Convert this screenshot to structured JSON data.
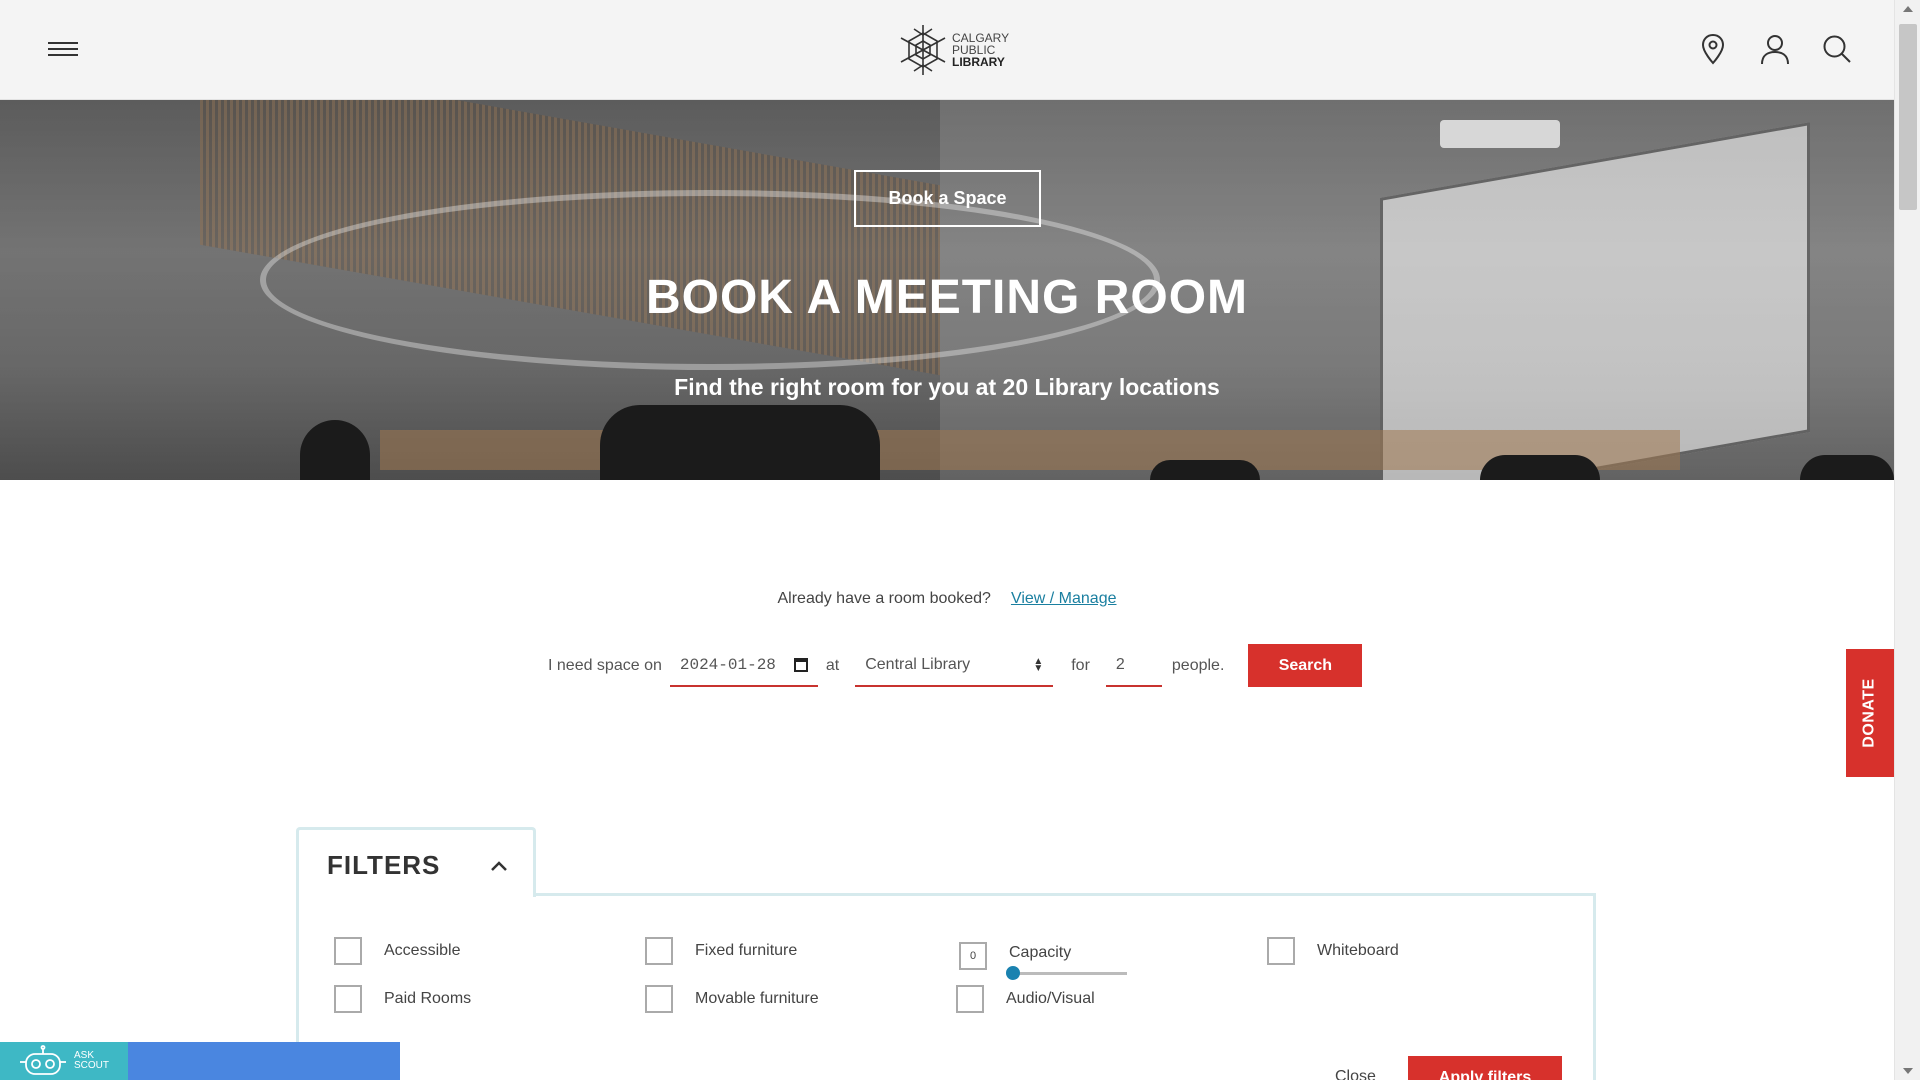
{
  "header": {
    "logo": {
      "line1": "CALGARY",
      "line2": "PUBLIC",
      "line3": "LIBRARY"
    },
    "icons": [
      "menu-icon",
      "location-pin-icon",
      "user-icon",
      "search-icon"
    ]
  },
  "hero": {
    "button_label": "Book a Space",
    "title": "BOOK A MEETING ROOM",
    "subtitle": "Find the right room for you at 20 Library locations"
  },
  "booking": {
    "already_text": "Already have a room booked?",
    "manage_link": "View / Manage",
    "label_space_on": "I need space on",
    "date_value": "2024-01-28",
    "label_at": "at",
    "location_value": "Central Library",
    "label_for": "for",
    "people_value": "2",
    "label_people": "people.",
    "search_label": "Search"
  },
  "donate_label": "DONATE",
  "filters": {
    "title": "FILTERS",
    "options": {
      "accessible": "Accessible",
      "paid_rooms": "Paid Rooms",
      "fixed_furniture": "Fixed furniture",
      "movable_furniture": "Movable furniture",
      "capacity": "Capacity",
      "capacity_value": "0",
      "audio_visual": "Audio/Visual",
      "whiteboard": "Whiteboard"
    },
    "close_label": "Close",
    "apply_label": "Apply filters"
  },
  "scout": {
    "line1": "ASK",
    "line2": "SCOUT"
  },
  "colors": {
    "accent_red": "#d7312c",
    "link_blue": "#1a7fa0",
    "scout_teal": "#3eb8c5",
    "panel_border": "#d6eaed"
  }
}
